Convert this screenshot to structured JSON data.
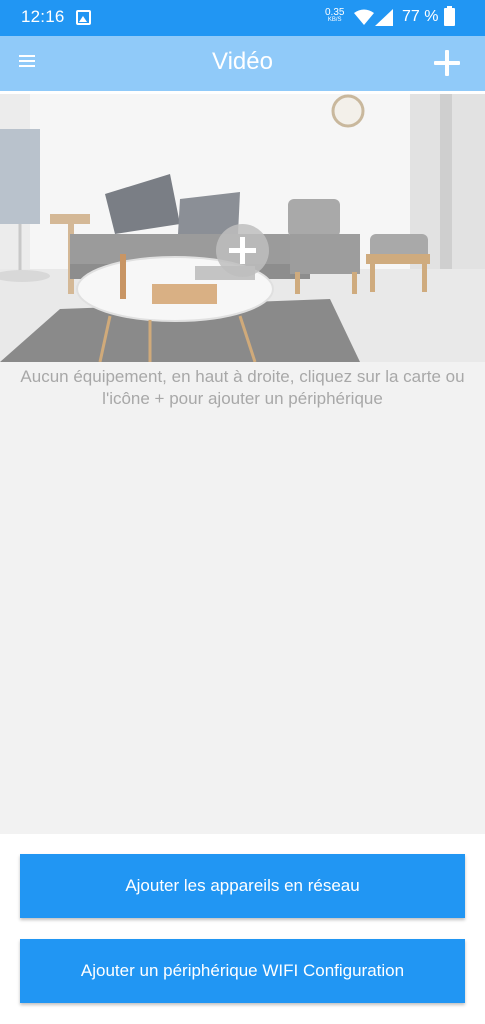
{
  "status_bar": {
    "time": "12:16",
    "net_speed_value": "0.35",
    "net_speed_unit": "KB/S",
    "battery_percent": "77 %"
  },
  "app_bar": {
    "title": "Vidéo",
    "menu_icon": "menu-icon",
    "add_icon": "plus-icon"
  },
  "hero": {
    "add_icon": "plus-circle-icon"
  },
  "empty_message": "Aucun équipement, en haut à droite, cliquez sur la carte ou l'icône + pour ajouter un périphérique",
  "buttons": {
    "network_label": "Ajouter les appareils en réseau",
    "wifi_label": "Ajouter un périphérique WIFI Configuration"
  },
  "colors": {
    "status_bar": "#2196f3",
    "app_bar": "#90caf9",
    "button": "#2196f3",
    "background": "#f2f2f2",
    "empty_text": "#a8a8a8"
  }
}
